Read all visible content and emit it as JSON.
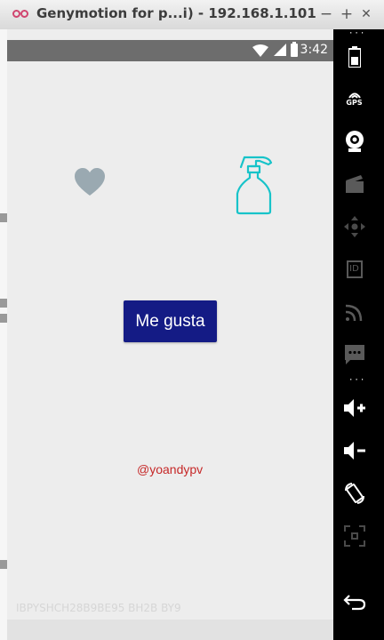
{
  "window": {
    "title": "Genymotion for p...i) - 192.168.1.101",
    "minimize": "−",
    "maximize": "+",
    "close": "✕"
  },
  "statusbar": {
    "time": "3:42"
  },
  "app": {
    "like_button": "Me gusta",
    "handle": "@yoandypv",
    "watermark": "IBPYSHCH28B9BE95 BH2B BY9"
  },
  "colors": {
    "button": "#141b85",
    "handle": "#c62828",
    "heart": "#9aa9b1",
    "bottle": "#17c3c9"
  },
  "toolbar": {
    "items": [
      "battery-icon",
      "gps-icon",
      "camera-icon",
      "clapperboard-icon",
      "dpad-icon",
      "id-icon",
      "rss-icon",
      "sms-icon",
      "volume-up-icon",
      "volume-down-icon",
      "rotate-icon",
      "resize-icon",
      "back-icon"
    ],
    "gps_label": "GPS",
    "id_label": "ID"
  }
}
